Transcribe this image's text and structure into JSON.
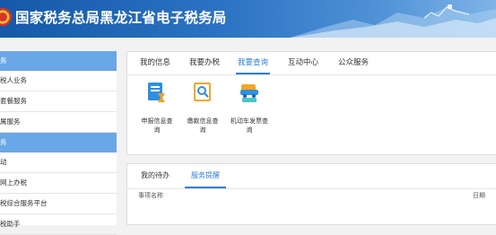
{
  "header": {
    "title": "国家税务总局黑龙江省电子税务局"
  },
  "sidebar": {
    "items": [
      {
        "label": "务",
        "kind": "category"
      },
      {
        "label": "税人业务",
        "kind": "item"
      },
      {
        "label": "套餐服务",
        "kind": "item"
      },
      {
        "label": "属服务",
        "kind": "item"
      },
      {
        "label": "务",
        "kind": "category"
      },
      {
        "label": "动",
        "kind": "item"
      },
      {
        "label": "网上办税",
        "kind": "item"
      },
      {
        "label": "税综合服务平台",
        "kind": "item"
      },
      {
        "label": "税助手",
        "kind": "item"
      }
    ]
  },
  "main": {
    "tabs": [
      "我的信息",
      "我要办税",
      "我要查询",
      "互动中心",
      "公众服务"
    ],
    "active_tab": "我要查询",
    "tiles": [
      {
        "label": "申报信息查询",
        "icon": "report-search-icon"
      },
      {
        "label": "缴款信息查询",
        "icon": "payment-search-icon"
      },
      {
        "label": "机动车发票查询",
        "icon": "vehicle-invoice-icon"
      }
    ]
  },
  "lower": {
    "tabs": [
      "我的待办",
      "服务提醒"
    ],
    "active_tab": "服务提醒",
    "columns": [
      "事项名称",
      "日期"
    ]
  },
  "colors": {
    "accent": "#2f7ed8",
    "sidebar_category": "#6aa7e6",
    "header": "#1f66b6"
  }
}
